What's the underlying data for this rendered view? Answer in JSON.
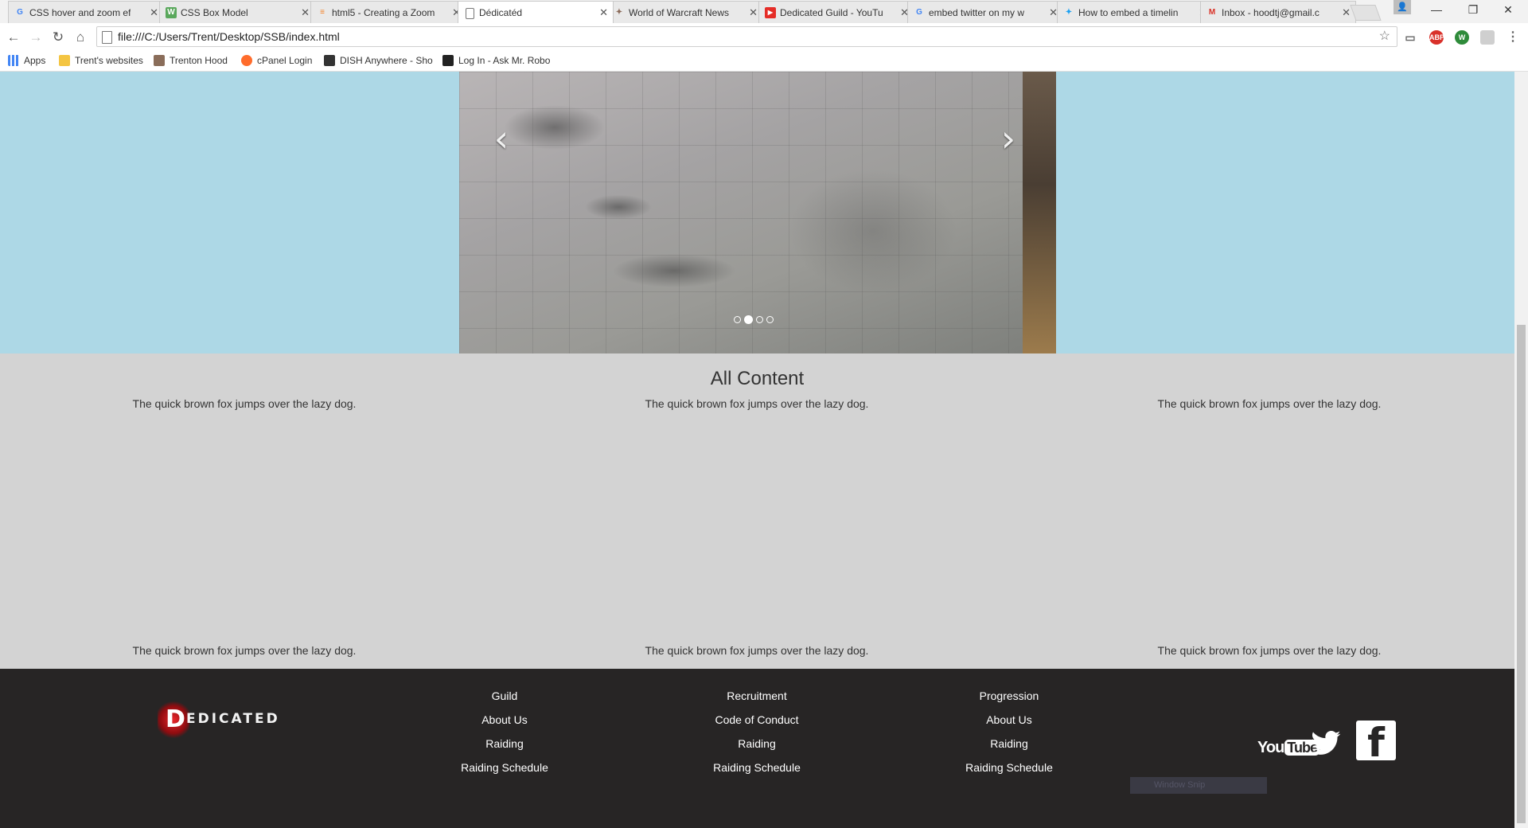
{
  "browser": {
    "tabs": [
      {
        "title": "CSS hover and zoom ef",
        "favicon": "google-icon",
        "color": "#4285f4",
        "glyph": "G"
      },
      {
        "title": "CSS Box Model",
        "favicon": "w3schools-icon",
        "color": "#5aa85c",
        "glyph": "W"
      },
      {
        "title": "html5 - Creating a Zoom",
        "favicon": "stackoverflow-icon",
        "color": "#f48024",
        "glyph": "S"
      },
      {
        "title": "Dédicatéd",
        "favicon": "page-icon",
        "color": "#ffffff",
        "glyph": ""
      },
      {
        "title": "World of Warcraft News",
        "favicon": "wow-icon",
        "color": "#8b6b5a",
        "glyph": "W"
      },
      {
        "title": "Dedicated Guild - YouTu",
        "favicon": "youtube-icon",
        "color": "#e52d27",
        "glyph": "▶"
      },
      {
        "title": "embed twitter on my w",
        "favicon": "google-icon",
        "color": "#4285f4",
        "glyph": "G"
      },
      {
        "title": "How to embed a timelin",
        "favicon": "twitter-icon",
        "color": "#1da1f2",
        "glyph": "t"
      },
      {
        "title": "Inbox - hoodtj@gmail.c",
        "favicon": "gmail-icon",
        "color": "#d93025",
        "glyph": "M"
      }
    ],
    "active_tab_index": 3,
    "address": "file:///C:/Users/Trent/Desktop/SSB/index.html",
    "bookmarks": [
      {
        "label": "Apps",
        "icon": "apps-grid-icon"
      },
      {
        "label": "Trent's websites",
        "icon": "folder-icon"
      },
      {
        "label": "Trenton Hood",
        "icon": "avatar-icon"
      },
      {
        "label": "cPanel Login",
        "icon": "cpanel-icon"
      },
      {
        "label": "DISH Anywhere - Sho",
        "icon": "dish-icon"
      },
      {
        "label": "Log In - Ask Mr. Robo",
        "icon": "robot-icon"
      }
    ],
    "extensions": [
      "cast-icon",
      "adblock-plus-icon",
      "w-extension-icon",
      "extension-icon",
      "menu-icon"
    ]
  },
  "carousel": {
    "prev_glyph": "‹",
    "next_glyph": "›",
    "slide_count": 4,
    "active_slide": 1
  },
  "content": {
    "title": "All Content",
    "top_row": [
      "The quick brown fox jumps over the lazy dog.",
      "The quick brown fox jumps over the lazy dog.",
      "The quick brown fox jumps over the lazy dog."
    ],
    "bottom_row": [
      "The quick brown fox jumps over the lazy dog.",
      "The quick brown fox jumps over the lazy dog.",
      "The quick brown fox jumps over the lazy dog."
    ]
  },
  "footer": {
    "logo_text": "EDICATED",
    "logo_mark": "D",
    "columns": [
      {
        "heading": "Guild",
        "links": [
          "About Us",
          "Raiding",
          "Raiding Schedule"
        ]
      },
      {
        "heading": "Recruitment",
        "links": [
          "Code of Conduct",
          "Raiding",
          "Raiding Schedule"
        ]
      },
      {
        "heading": "Progression",
        "links": [
          "About Us",
          "Raiding",
          "Raiding Schedule"
        ]
      }
    ],
    "social": {
      "youtube_you": "You",
      "youtube_tube": "Tube",
      "facebook_glyph": "f"
    },
    "window_snip": "Window Snip"
  },
  "colors": {
    "hero_bg": "#add8e6",
    "content_bg": "#d3d3d3",
    "footer_bg": "#272525",
    "logo_red": "#e8262a"
  }
}
